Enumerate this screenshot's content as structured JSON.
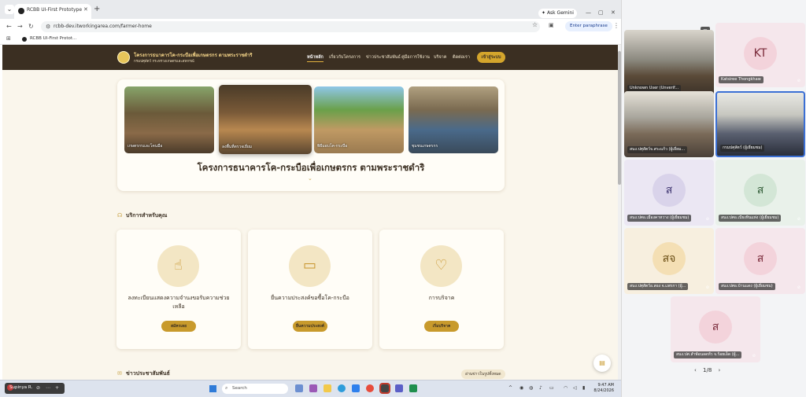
{
  "browser": {
    "tab_title": "RCBB UI-First Prototype",
    "new_tab": "+",
    "ask_gemini": "Ask Gemini",
    "url": "rcbb-dev.itworkingarea.com/farmer-home",
    "paraphrase_label": "Enter paraphrase",
    "bookmark": "RCBB UI-First Protot..."
  },
  "site": {
    "org_title": "โครงการธนาคารโค-กระบือเพื่อเกษตรกร ตามพระราชดำริ",
    "org_sub": "กรมปศุสัตว์ กระทรวงเกษตรและสหกรณ์",
    "nav": [
      "หน้าหลัก",
      "เกี่ยวกับโครงการ",
      "ข่าวประชาสัมพันธ์",
      "คู่มือการใช้งาน",
      "บริจาค",
      "ติดต่อเรา"
    ],
    "login": "เข้าสู่ระบบ",
    "photos": [
      "เกษตรกรและโคนมือ",
      "ลงพื้นที่ตรวจเยี่ยม",
      "พิธีมอบโค-กระบือ",
      "ชุมชนเกษตรกร"
    ],
    "hero_title": "โครงการธนาคารโค-กระบือเพื่อเกษตรกร ตามพระราชดำริ",
    "services_title": "บริการสำหรับคุณ",
    "cards": [
      {
        "title": "ลงทะเบียนแสดงความจำนงขอรับความช่วยเหลือ",
        "button": "สมัครเลย",
        "icon": "hand-pointer-icon"
      },
      {
        "title": "ยื่นความประสงค์ขอซื้อโค-กระบือ",
        "button": "ยื่นความประสงค์",
        "icon": "money-icon"
      },
      {
        "title": "การบริจาค",
        "button": "เริ่มบริจาค",
        "icon": "donate-hand-icon"
      }
    ],
    "news_title": "ข่าวประชาสัมพันธ์",
    "news_more": "อ่านข่าวในรูปทั้งหมด"
  },
  "taskbar": {
    "user": "Supinya R.",
    "search": "Search",
    "time": "9:47 AM",
    "date": "8/24/2026"
  },
  "meeting": {
    "participants": [
      {
        "name": "Unknown User (Unverif...",
        "type": "video"
      },
      {
        "name": "Katsiree Thongkhaw",
        "initials": "KT",
        "type": "avatar"
      },
      {
        "name": "สนง.ปศุสัตว์จ.สระแก้ว (ผู้เยี่ยม...",
        "type": "video"
      },
      {
        "name": "กรมปศุสัตว์ (ผู้เยี่ยมชม)",
        "type": "video"
      },
      {
        "name": "สนง.ปศอ.เมืองคาหวาง (ผู้เยี่ยมชม)",
        "initials": "ส",
        "type": "avatar"
      },
      {
        "name": "สนง.ปศอ.เบียงหินแท่ง (ผู้เยี่ยมชม)",
        "initials": "ส",
        "type": "avatar"
      },
      {
        "name": "สนง.ปศุสัตว์อ.สอง จ.แพรกา (ผู้...",
        "initials": "สจ",
        "type": "avatar"
      },
      {
        "name": "สนง.ปศอ.บ้านแดง (ผู้เยี่ยมชม)",
        "initials": "ส",
        "type": "avatar"
      },
      {
        "name": "สนง.ปศ.สำพ้อนลดทั่ว จ.ร้อยเอ็ด (ผู้...",
        "initials": "ส",
        "type": "avatar"
      }
    ],
    "page": "1/8"
  }
}
